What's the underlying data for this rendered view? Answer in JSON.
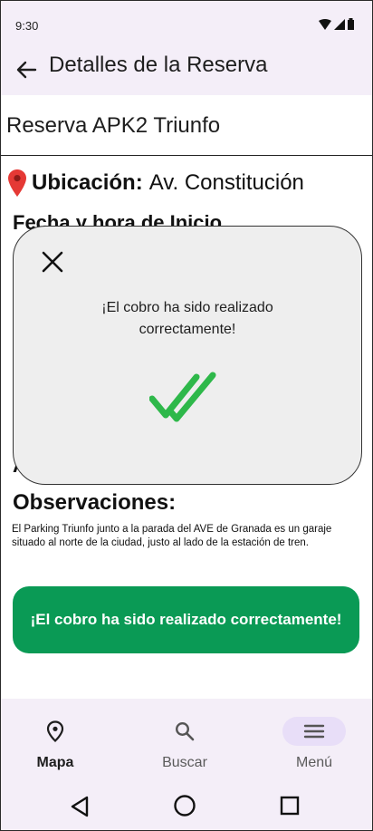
{
  "status": {
    "time": "9:30"
  },
  "header": {
    "title": "Detalles de la Reserva"
  },
  "reservation": {
    "title": "Reserva APK2 Triunfo",
    "location_label": "Ubicación:",
    "location_value": "Av. Constitución",
    "start_heading_partial": "Fecha y hora de Inicio",
    "hidden_heading_initial": "A",
    "observations_heading": "Observaciones:",
    "observations_text": "El Parking Triunfo junto a la parada del AVE de Granada es un garaje situado al norte de la ciudad, justo al lado de la estación de tren."
  },
  "charge_button": {
    "label": "¡El cobro ha sido realizado correctamente!"
  },
  "modal": {
    "message": "¡El cobro ha sido realizado correctamente!"
  },
  "bottom_nav": [
    {
      "label": "Mapa",
      "icon": "location-pin-icon"
    },
    {
      "label": "Buscar",
      "icon": "search-icon"
    },
    {
      "label": "Menú",
      "icon": "menu-icon"
    }
  ],
  "colors": {
    "accent": "#0a9a55",
    "check": "#2eb84a",
    "bar": "#f4eef8",
    "pin": "#e53935"
  }
}
